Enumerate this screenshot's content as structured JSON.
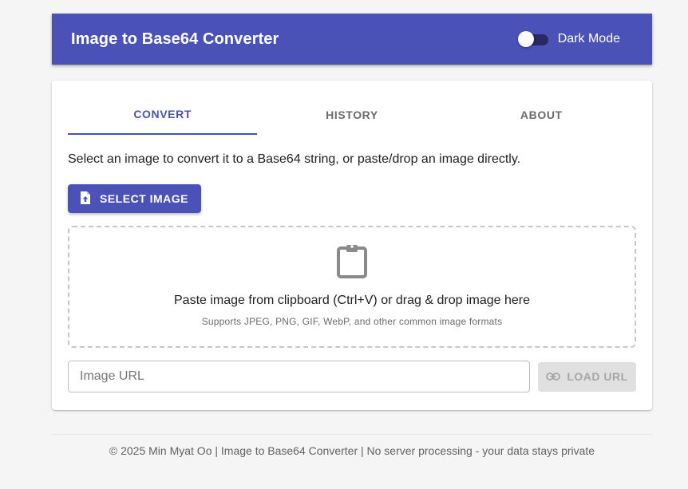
{
  "header": {
    "title": "Image to Base64 Converter",
    "dark_mode_label": "Dark Mode",
    "dark_mode_on": false,
    "color": "#4a52b8"
  },
  "tabs": [
    {
      "label": "CONVERT",
      "active": true
    },
    {
      "label": "HISTORY",
      "active": false
    },
    {
      "label": "ABOUT",
      "active": false
    }
  ],
  "convert": {
    "intro": "Select an image to convert it to a Base64 string, or paste/drop an image directly.",
    "select_button": "SELECT IMAGE",
    "select_icon": "file-upload-icon",
    "dropzone": {
      "icon": "clipboard-icon",
      "title": "Paste image from clipboard (Ctrl+V) or drag & drop image here",
      "subtitle": "Supports JPEG, PNG, GIF, WebP, and other common image formats"
    },
    "url_input": {
      "placeholder": "Image URL",
      "value": ""
    },
    "load_button": "LOAD URL",
    "load_icon": "link-icon"
  },
  "footer": {
    "text": "© 2025 Min Myat Oo | Image to Base64 Converter | No server processing - your data stays private"
  }
}
